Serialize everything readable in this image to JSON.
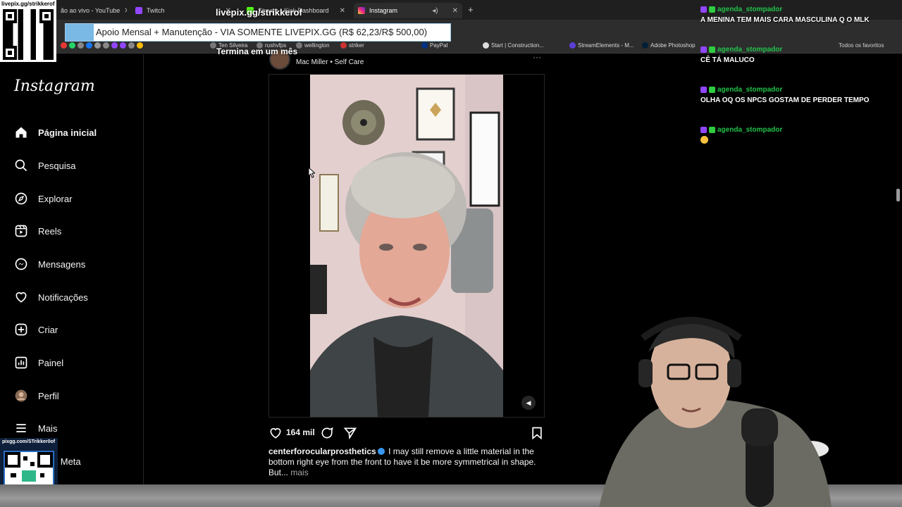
{
  "browser": {
    "tabs": [
      {
        "label": "ão ao vivo - YouTube",
        "active": false
      },
      {
        "label": "Twitch",
        "active": false
      },
      {
        "label": "Stream - Kick Dashboard",
        "active": false
      },
      {
        "label": "Instagram",
        "active": true
      }
    ],
    "new_tab_symbol": "+",
    "bookmarks": [
      {
        "label": "Ten Silveira"
      },
      {
        "label": "rushvfps"
      },
      {
        "label": "wellington"
      },
      {
        "label": "striker"
      },
      {
        "label": "PayPal"
      },
      {
        "label": "Start | Construction..."
      },
      {
        "label": "StreamElements - M..."
      },
      {
        "label": "Adobe Photoshop"
      }
    ],
    "all_bookmarks": "Todos os favoritos"
  },
  "overlay": {
    "qr_top_label": "livepix.gg/strikkerof",
    "stream_title": "livepix.gg/strikkerof",
    "livepix_banner": "Apoio Mensal + Manutenção - VIA SOMENTE LIVEPIX.GG (R$ 62,23/R$ 500,00)",
    "livepix_subtitle": "Termina em um mês",
    "qr_bottom_label": "pixgg.com/STrikker0of"
  },
  "instagram": {
    "logo": "Instagram",
    "nav": [
      {
        "label": "Página inicial",
        "icon": "home-icon"
      },
      {
        "label": "Pesquisa",
        "icon": "search-icon"
      },
      {
        "label": "Explorar",
        "icon": "compass-icon"
      },
      {
        "label": "Reels",
        "icon": "reels-icon"
      },
      {
        "label": "Mensagens",
        "icon": "messenger-icon"
      },
      {
        "label": "Notificações",
        "icon": "heart-icon"
      },
      {
        "label": "Criar",
        "icon": "plus-square-icon"
      },
      {
        "label": "Painel",
        "icon": "dashboard-icon"
      },
      {
        "label": "Perfil",
        "icon": "avatar"
      },
      {
        "label": "Mais",
        "icon": "menu-icon"
      },
      {
        "label": "ém da Meta",
        "icon": ""
      }
    ],
    "post": {
      "audio": "Mac Miller • Self Care",
      "more": "···",
      "likes": "164 mil",
      "username": "centerforocularprosthetics",
      "caption": "I may still remove a little material in the bottom right eye from the front to have it be more symmetrical in shape. But...",
      "more_link": "mais"
    }
  },
  "chat": [
    {
      "user": "agenda_stompador",
      "text": "A MENINA TEM MAIS CARA MASCULINA Q O MLK"
    },
    {
      "user": "agenda_stompador",
      "text": "CÊ TÁ MALUCO"
    },
    {
      "user": "agenda_stompador",
      "text": "OLHA OQ OS NPCS GOSTAM DE PERDER TEMPO"
    },
    {
      "user": "agenda_stompador",
      "text": ""
    }
  ],
  "colors": {
    "chat_username": "#22c24a",
    "twitch_purple": "#9146ff",
    "instagram_bg": "#000000",
    "verified": "#3897f0"
  }
}
